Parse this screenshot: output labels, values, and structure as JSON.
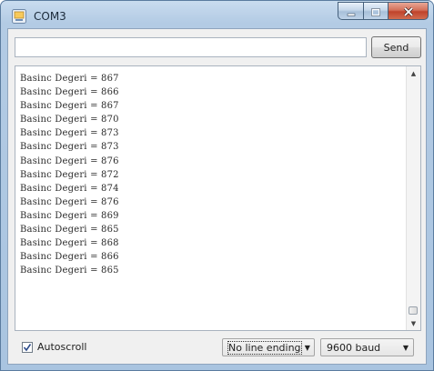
{
  "window": {
    "title": "COM3"
  },
  "input": {
    "value": "",
    "placeholder": ""
  },
  "send_button": {
    "label": "Send"
  },
  "output": {
    "lines": [
      "Basinc Degeri = 867",
      "Basinc Degeri = 866",
      "Basinc Degeri = 867",
      "Basinc Degeri = 870",
      "Basinc Degeri = 873",
      "Basinc Degeri = 873",
      "Basinc Degeri = 876",
      "Basinc Degeri = 872",
      "Basinc Degeri = 874",
      "Basinc Degeri = 876",
      "Basinc Degeri = 869",
      "Basinc Degeri = 865",
      "Basinc Degeri = 868",
      "Basinc Degeri = 866",
      "Basinc Degeri = 865"
    ]
  },
  "footer": {
    "autoscroll_label": "Autoscroll",
    "autoscroll_checked": true,
    "line_ending": "No line ending",
    "baud_rate": "9600 baud"
  },
  "colors": {
    "close_button": "#c0432b",
    "window_frame": "#a9c4e0"
  }
}
